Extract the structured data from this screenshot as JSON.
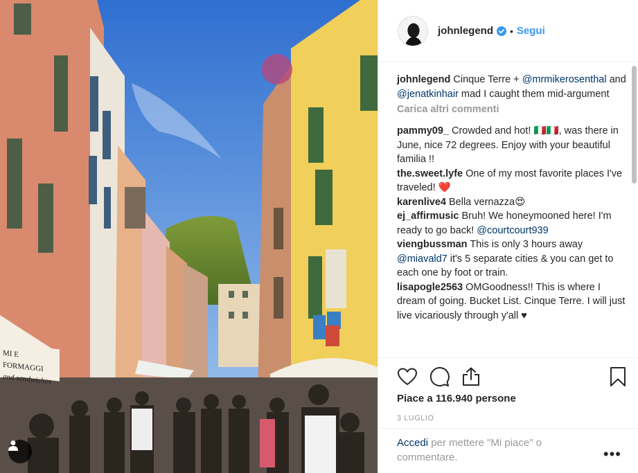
{
  "header": {
    "username": "johnlegend",
    "separator": "•",
    "follow_label": "Segui"
  },
  "caption": {
    "username": "johnlegend",
    "text_before": "Cinque Terre + ",
    "mention1": "@mrmikerosenthal",
    "text_mid": " and ",
    "mention2": "@jenatkinhair",
    "text_after": " mad I caught them mid-argument"
  },
  "load_more_label": "Carica altri commenti",
  "comments": [
    {
      "user": "pammy09_",
      "text": "Crowded and hot! 🇮🇹🇮🇹, was there in June, nice 72 degrees. Enjoy with your beautiful familia !!"
    },
    {
      "user": "the.sweet.lyfe",
      "text": "One of my most favorite places I've traveled! ❤️"
    },
    {
      "user": "karenlive4",
      "text": "Bella vernazza😍"
    },
    {
      "user": "ej_affirmusic",
      "text": "Bruh! We honeymooned here! I'm ready to go back!",
      "mention": "@courtcourt939",
      "after": ""
    },
    {
      "user": "viengbussman",
      "text": "This is only 3 hours away",
      "mention": "@miavald7",
      "after": " it's 5 separate cities & you can get to each one by foot or train."
    },
    {
      "user": "lisapogle2563",
      "text": "OMGoodness!! This is where I dream of going. Bucket List. Cinque Terre. I will just live vicariously through y'all ♥"
    }
  ],
  "likes_text": "Piace a 116.940 persone",
  "date_text": "3 LUGLIO",
  "footer": {
    "login_link": "Accedi",
    "login_rest": " per mettere \"Mi piace\" o commentare.",
    "more_label": "•••"
  },
  "icons": [
    "heart-icon",
    "comment-icon",
    "share-icon",
    "bookmark-icon",
    "verified-icon",
    "user-tag-icon"
  ],
  "colors": {
    "link": "#3897f0",
    "mention": "#003569",
    "muted": "#999999",
    "verified": "#3897f0"
  },
  "photo_sign": {
    "line1": "MI E FORMAGGI",
    "line2": "and sandwiches"
  }
}
